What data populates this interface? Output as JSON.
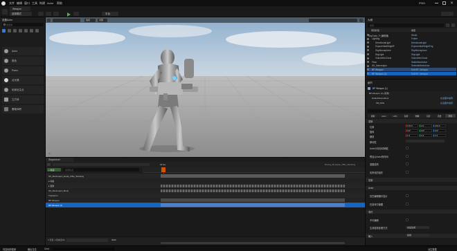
{
  "window": {
    "title": "P001",
    "level_tab": "Weapon"
  },
  "menu": [
    "文件",
    "编辑",
    "窗口",
    "工具",
    "构建",
    "Actor",
    "帮助"
  ],
  "toolbar": {
    "mode": "选择模式",
    "platform": "平台"
  },
  "left_panel": {
    "title": "放置Actor",
    "search_placeholder": "搜索类",
    "items": [
      {
        "label": "Actor",
        "icon": "actor-icon"
      },
      {
        "label": "角色",
        "icon": "character-icon"
      },
      {
        "label": "Pawn",
        "icon": "pawn-icon"
      },
      {
        "label": "点光源",
        "icon": "point-light-icon"
      },
      {
        "label": "玩家出生点",
        "icon": "player-start-icon"
      },
      {
        "label": "立方体",
        "icon": "cube-icon"
      },
      {
        "label": "基础体积",
        "icon": "box-volume-icon"
      }
    ]
  },
  "viewport": {
    "mode": "透视",
    "lighting": "光照"
  },
  "sequencer": {
    "tab": "Sequencer",
    "add_track": "+ 轨道",
    "search_placeholder": "搜索轨道",
    "sequence_name": "Driving_Bl_Equip_Rifle_Standing",
    "fps": "30 fps",
    "tracks": [
      "  SK_Mannequin_Equip_Rifle_Standing",
      "  ▸ 动画",
      "  ▸ 变换",
      "  SK_Mannequin_Body",
      "  Transform",
      "  BP Weapon",
      "  BP Weapon (1)"
    ],
    "selected_track": "BP Weapon (1)",
    "timecode": "0000",
    "item_count": "0 项目 (1项被选中)"
  },
  "outliner": {
    "title": "大纲",
    "search_placeholder": "搜索...",
    "col_label": "项目标签",
    "col_type": "类型",
    "rows": [
      {
        "label": "SkyCube_P (编辑器)",
        "type": "World"
      },
      {
        "label": "Lighting",
        "type": "Folder"
      },
      {
        "label": "DirectionalLight",
        "type": "DirectionalLight"
      },
      {
        "label": "ExponentialHeightF",
        "type": "ExponentialHeightFog"
      },
      {
        "label": "SkyAtmosphere",
        "type": "SkyAtmosphere"
      },
      {
        "label": "SkyLight",
        "type": "SkyLight"
      },
      {
        "label": "VolumetricCloud",
        "type": "VolumetricCloud"
      },
      {
        "label": "Floor",
        "type": "StaticMeshActor"
      },
      {
        "label": "SK_Mannequin",
        "type": "SkeletalMeshActor"
      },
      {
        "label": "BP Weapon",
        "type": "Edit BP_Weapon"
      },
      {
        "label": "BP Weapon (1)",
        "type": "Edit BP_Weapon"
      }
    ]
  },
  "details": {
    "title": "细节",
    "actor": "BP Weapon (1)",
    "instance": "BP Weapon (1) (实例)",
    "components": [
      "DefaultSceneRoot",
      "SM_Rifle"
    ],
    "edit_bp": "在蓝图中编辑",
    "tabs": [
      "通用",
      "Actor",
      "LOD",
      "杂项",
      "物理",
      "渲染",
      "流送",
      "所有"
    ],
    "section_transform": "变换",
    "transform": [
      {
        "label": "位置",
        "values": [
          "170.0",
          "2.0",
          "133.0"
        ]
      },
      {
        "label": "旋转",
        "values": [
          "0.0°",
          "0.0°",
          "0.0°"
        ]
      },
      {
        "label": "缩放",
        "values": [
          "1.0",
          "1.0",
          "1.0"
        ]
      }
    ],
    "mobility": "移动性",
    "rows": [
      "Actor计划自动销毁",
      "附加父Actor的时间",
      "蓝图结构",
      "实例化的组件",
      "复制",
      "Actor",
      "仅在编辑器中显示",
      "在游戏中隐藏",
      "事件",
      "不可编辑",
      "生成碰撞处理方式",
      "输入"
    ],
    "spawn_value": "总是生成",
    "input_value": "禁用"
  },
  "status": {
    "left": "内容侧滑菜单",
    "output": "输出日志",
    "cmd": "Cmd",
    "right": "派生数据"
  }
}
